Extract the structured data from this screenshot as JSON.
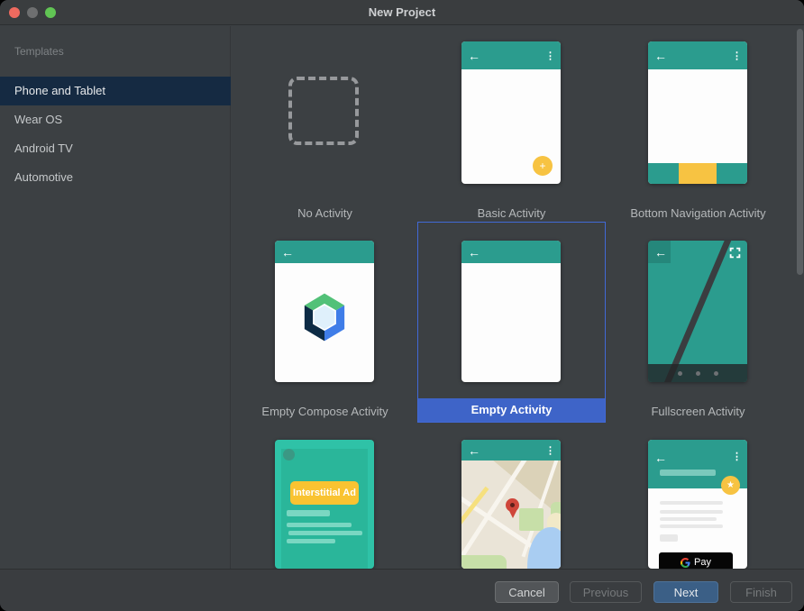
{
  "window": {
    "title": "New Project"
  },
  "icons": {
    "back": "←",
    "kebab": "⋮",
    "plus": "+",
    "star": "★"
  },
  "sidebar": {
    "header": "Templates",
    "items": [
      {
        "label": "Phone and Tablet",
        "selected": true
      },
      {
        "label": "Wear OS",
        "selected": false
      },
      {
        "label": "Android TV",
        "selected": false
      },
      {
        "label": "Automotive",
        "selected": false
      }
    ]
  },
  "grid": {
    "items": [
      {
        "label": "No Activity",
        "selected": false
      },
      {
        "label": "Basic Activity",
        "selected": false
      },
      {
        "label": "Bottom Navigation Activity",
        "selected": false
      },
      {
        "label": "Empty Compose Activity",
        "selected": false
      },
      {
        "label": "Empty Activity",
        "selected": true
      },
      {
        "label": "Fullscreen Activity",
        "selected": false
      }
    ],
    "mockups": {
      "interstitial_button_label": "Interstitial Ad",
      "gpay_button_label": "Pay"
    }
  },
  "footer": {
    "buttons": [
      {
        "label": "Cancel",
        "state": "enabled"
      },
      {
        "label": "Previous",
        "state": "disabled"
      },
      {
        "label": "Next",
        "state": "default"
      },
      {
        "label": "Finish",
        "state": "disabled"
      }
    ]
  },
  "colors": {
    "teal_header": "#2b9c8e",
    "amber_accent": "#f7c342",
    "selection_blue": "#3e64c8",
    "selection_border": "#4169d6",
    "primary_button_blue": "#3b5f86",
    "sidebar_selected_navy": "#152a42",
    "window_background": "#3c4043"
  }
}
